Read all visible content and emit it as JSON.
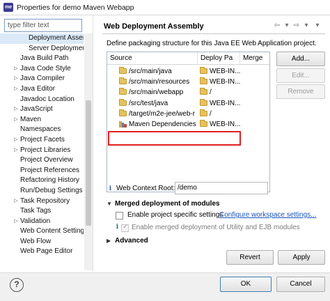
{
  "window": {
    "icon_text": "me",
    "title": "Properties for demo Maven Webapp"
  },
  "left_panel": {
    "filter_placeholder": "type filter text",
    "tree": [
      {
        "label": "Deployment Asser",
        "child": true,
        "selected": true,
        "arrow": ""
      },
      {
        "label": "Server Deploymen",
        "child": true,
        "selected": false,
        "arrow": ""
      },
      {
        "label": "Java Build Path",
        "child": false,
        "selected": false,
        "arrow": ""
      },
      {
        "label": "Java Code Style",
        "child": false,
        "selected": false,
        "arrow": "▷"
      },
      {
        "label": "Java Compiler",
        "child": false,
        "selected": false,
        "arrow": "▷"
      },
      {
        "label": "Java Editor",
        "child": false,
        "selected": false,
        "arrow": "▷"
      },
      {
        "label": "Javadoc Location",
        "child": false,
        "selected": false,
        "arrow": ""
      },
      {
        "label": "JavaScript",
        "child": false,
        "selected": false,
        "arrow": "▷"
      },
      {
        "label": "Maven",
        "child": false,
        "selected": false,
        "arrow": "▷"
      },
      {
        "label": "Namespaces",
        "child": false,
        "selected": false,
        "arrow": ""
      },
      {
        "label": "Project Facets",
        "child": false,
        "selected": false,
        "arrow": "▷"
      },
      {
        "label": "Project Libraries",
        "child": false,
        "selected": false,
        "arrow": "▷"
      },
      {
        "label": "Project Overview",
        "child": false,
        "selected": false,
        "arrow": ""
      },
      {
        "label": "Project References",
        "child": false,
        "selected": false,
        "arrow": ""
      },
      {
        "label": "Refactoring History",
        "child": false,
        "selected": false,
        "arrow": ""
      },
      {
        "label": "Run/Debug Settings",
        "child": false,
        "selected": false,
        "arrow": ""
      },
      {
        "label": "Task Repository",
        "child": false,
        "selected": false,
        "arrow": "▷"
      },
      {
        "label": "Task Tags",
        "child": false,
        "selected": false,
        "arrow": ""
      },
      {
        "label": "Validation",
        "child": false,
        "selected": false,
        "arrow": "▷"
      },
      {
        "label": "Web Content Settings",
        "child": false,
        "selected": false,
        "arrow": ""
      },
      {
        "label": "Web Flow",
        "child": false,
        "selected": false,
        "arrow": ""
      },
      {
        "label": "Web Page Editor",
        "child": false,
        "selected": false,
        "arrow": ""
      },
      {
        "label": "",
        "child": false,
        "selected": false,
        "arrow": ""
      }
    ]
  },
  "page": {
    "title": "Web Deployment Assembly",
    "description": "Define packaging structure for this Java EE Web Application project.",
    "table": {
      "headers": [
        "Source",
        "Deploy Pa",
        "Merge"
      ],
      "rows": [
        {
          "source": "/src/main/java",
          "deploy": "WEB-IN...",
          "icon": "folder"
        },
        {
          "source": "/src/main/resources",
          "deploy": "WEB-IN...",
          "icon": "folder"
        },
        {
          "source": "/src/main/webapp",
          "deploy": "/",
          "icon": "folder"
        },
        {
          "source": "/src/test/java",
          "deploy": "WEB-IN...",
          "icon": "folder"
        },
        {
          "source": "/target/m2e-jee/web-r",
          "deploy": "/",
          "icon": "folder"
        },
        {
          "source": "Maven Dependencies",
          "deploy": "WEB-IN...",
          "icon": "maven"
        }
      ]
    },
    "buttons": {
      "add": "Add...",
      "edit": "Edit...",
      "remove": "Remove"
    },
    "context_root_label": "Web Context Root:",
    "context_root_value": "/demo",
    "merged_section_title": "Merged deployment of modules",
    "enable_specific_label": "Enable project specific settings",
    "configure_link": "Configure workspace settings...",
    "enable_merged_label": "Enable merged deployment of Utility and EJB modules",
    "advanced_title": "Advanced",
    "revert": "Revert",
    "apply": "Apply"
  },
  "footer": {
    "help": "?",
    "ok": "OK",
    "cancel": "Cancel"
  },
  "colors": {
    "highlight_border": "#e02020",
    "link": "#1a55b8",
    "selection": "#dbe9f8"
  }
}
